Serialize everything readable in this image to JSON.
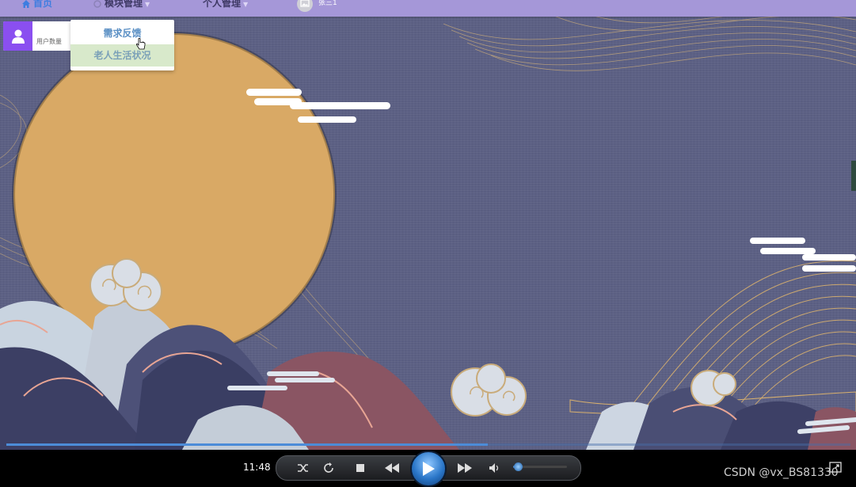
{
  "nav": {
    "home_label": "首页",
    "module_label": "模块管理",
    "personal_label": "个人管理",
    "username": "张三1"
  },
  "stat_card": {
    "label": "用户数量"
  },
  "dropdown": {
    "items": [
      {
        "label": "需求反馈"
      },
      {
        "label": "老人生活状况"
      }
    ]
  },
  "player": {
    "time": "11:48",
    "progress": 0.57,
    "volume": 0.1
  },
  "watermark": "CSDN @vx_BS81330",
  "colors": {
    "navbar": "#a597d8",
    "background": "#5c6084",
    "moon": "#d9a965",
    "accent": "#8a4ff0"
  }
}
